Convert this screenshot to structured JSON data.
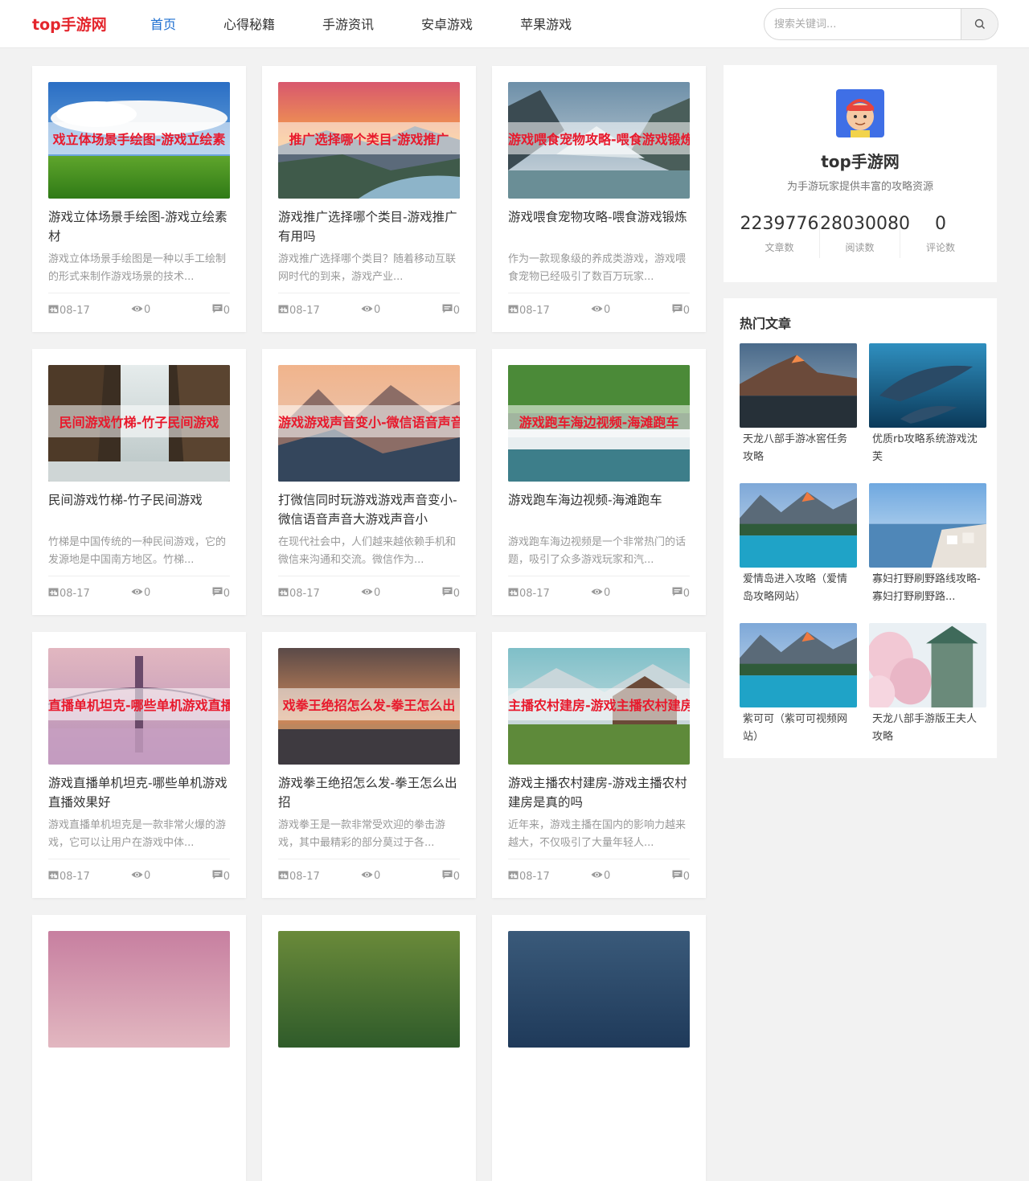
{
  "header": {
    "logo": "top手游网",
    "nav": [
      "首页",
      "心得秘籍",
      "手游资讯",
      "安卓游戏",
      "苹果游戏"
    ],
    "search_placeholder": "搜索关键词..."
  },
  "cards": [
    {
      "band": "戏立体场景手绘图-游戏立绘素",
      "title": "游戏立体场景手绘图-游戏立绘素材",
      "desc": "游戏立体场景手绘图是一种以手工绘制的形式来制作游戏场景的技术...",
      "date": "08-17",
      "views": "0",
      "comments": "0",
      "theme": "meadow"
    },
    {
      "band": "推广选择哪个类目-游戏推广",
      "title": "游戏推广选择哪个类目-游戏推广有用吗",
      "desc": "游戏推广选择哪个类目？随着移动互联网时代的到来，游戏产业...",
      "date": "08-17",
      "views": "0",
      "comments": "0",
      "theme": "sunset-canyon"
    },
    {
      "band": "游戏喂食宠物攻略-喂食游戏锻炼",
      "title": "游戏喂食宠物攻略-喂食游戏锻炼",
      "desc": "作为一款现象级的养成类游戏，游戏喂食宠物已经吸引了数百万玩家...",
      "date": "08-17",
      "views": "0",
      "comments": "0",
      "theme": "fjord"
    },
    {
      "band": "民间游戏竹梯-竹子民间游戏",
      "title": "民间游戏竹梯-竹子民间游戏",
      "desc": "竹梯是中国传统的一种民间游戏，它的发源地是中国南方地区。竹梯...",
      "date": "08-17",
      "views": "0",
      "comments": "0",
      "theme": "waterfall"
    },
    {
      "band": "游戏游戏声音变小-微信语音声音",
      "title": "打微信同时玩游戏游戏声音变小-微信语音声音大游戏声音小",
      "desc": "在现代社会中，人们越来越依赖手机和微信来沟通和交流。微信作为...",
      "date": "08-17",
      "views": "0",
      "comments": "0",
      "theme": "mountain-dusk"
    },
    {
      "band": "游戏跑车海边视频-海滩跑车",
      "title": "游戏跑车海边视频-海滩跑车",
      "desc": "游戏跑车海边视频是一个非常热门的话题，吸引了众多游戏玩家和汽...",
      "date": "08-17",
      "views": "0",
      "comments": "0",
      "theme": "forest-falls"
    },
    {
      "band": "直播单机坦克-哪些单机游戏直播效",
      "title": "游戏直播单机坦克-哪些单机游戏直播效果好",
      "desc": "游戏直播单机坦克是一款非常火爆的游戏，它可以让用户在游戏中体...",
      "date": "08-17",
      "views": "0",
      "comments": "0",
      "theme": "bridge"
    },
    {
      "band": "戏拳王绝招怎么发-拳王怎么出",
      "title": "游戏拳王绝招怎么发-拳王怎么出招",
      "desc": "游戏拳王是一款非常受欢迎的拳击游戏，其中最精彩的部分莫过于各...",
      "date": "08-17",
      "views": "0",
      "comments": "0",
      "theme": "sea-sunset"
    },
    {
      "band": "主播农村建房-游戏主播农村建房是",
      "title": "游戏主播农村建房-游戏主播农村建房是真的吗",
      "desc": "近年来，游戏主播在国内的影响力越来越大，不仅吸引了大量年轻人...",
      "date": "08-17",
      "views": "0",
      "comments": "0",
      "theme": "cabin"
    }
  ],
  "partial_cards": [
    "pink",
    "green",
    "navy"
  ],
  "profile": {
    "name": "top手游网",
    "tagline": "为手游玩家提供丰富的攻略资源",
    "stats": [
      {
        "value": "2239776",
        "label": "文章数"
      },
      {
        "value": "28030080",
        "label": "阅读数"
      },
      {
        "value": "0",
        "label": "评论数"
      }
    ]
  },
  "hot": {
    "title": "热门文章",
    "items": [
      {
        "text": "天龙八部手游冰窖任务攻略",
        "theme": "lake-peak"
      },
      {
        "text": "优质rb攻略系统游戏沈芙",
        "theme": "dolphins"
      },
      {
        "text": "爱情岛进入攻略（爱情岛攻略网站）",
        "theme": "glacier-lake"
      },
      {
        "text": "寡妇打野刷野路线攻略-寡妇打野刷野路...",
        "theme": "santorini"
      },
      {
        "text": "紫可可（紫可可视频网站）",
        "theme": "glacier-lake"
      },
      {
        "text": "天龙八部手游版王夫人攻略",
        "theme": "castle"
      }
    ]
  },
  "colors": {
    "accent": "#1e6fd0",
    "brand": "#e4262d",
    "band_text": "#e8192c"
  }
}
